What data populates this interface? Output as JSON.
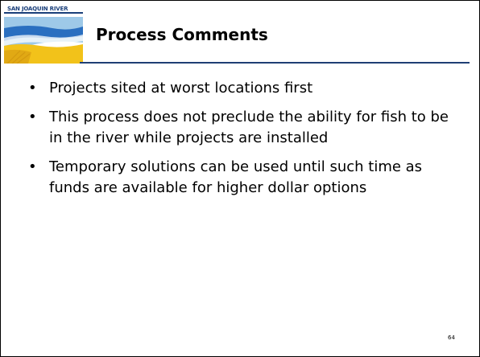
{
  "slide": {
    "logo_text": "SAN JOAQUIN RIVER",
    "title": "Process Comments",
    "bullets": [
      "Projects sited at worst locations first",
      "This process does not preclude the ability for fish to be in the river while projects are installed",
      "Temporary solutions can be used until such time as funds are available for higher dollar options"
    ],
    "page_number": "64"
  },
  "colors": {
    "rule": "#1f3f74",
    "logo_blue": "#1a3f7a",
    "logo_yellow": "#f2c21a",
    "logo_sky": "#9ec9e8"
  },
  "icons": {
    "logo": "river-landscape-logo",
    "bullet": "bullet-dot"
  }
}
